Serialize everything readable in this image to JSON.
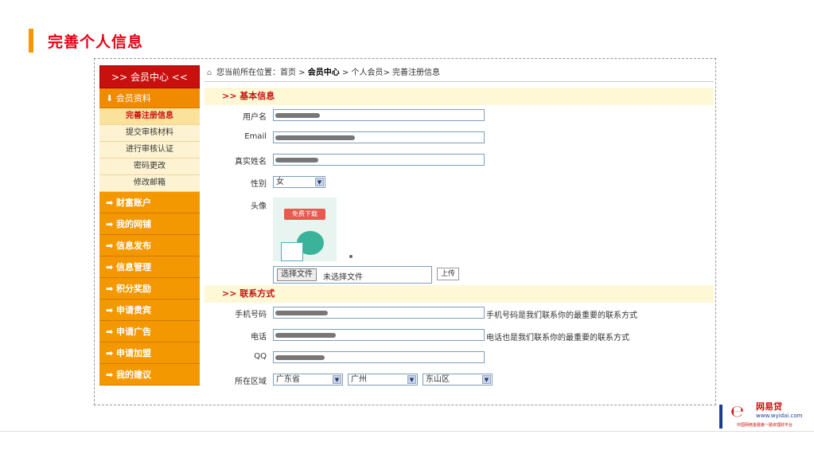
{
  "page_title": "完善个人信息",
  "sidebar": {
    "header": ">> 会员中心 <<",
    "section_member": "⬇ 会员资料",
    "sub_items": [
      "完善注册信息",
      "提交审核材料",
      "进行审核认证",
      "密码更改",
      "修改邮箱"
    ],
    "sections": [
      "➡ 财富账户",
      "➡ 我的网铺",
      "➡ 信息发布",
      "➡ 信息管理",
      "➡ 积分奖励",
      "➡ 申请贵宾",
      "➡ 申请广告",
      "➡ 申请加盟",
      "➡ 我的建议"
    ]
  },
  "breadcrumb": {
    "prefix": "您当前所在位置：首页 > ",
    "member_center": "会员中心",
    "suffix": " > 个人会员> 完善注册信息"
  },
  "basic_section_title": ">> 基本信息",
  "contact_section_title": ">> 联系方式",
  "form": {
    "username_label": "用户名",
    "email_label": "Email",
    "realname_label": "真实姓名",
    "gender_label": "性别",
    "gender_value": "女",
    "avatar_label": "头像",
    "avatar_badge": "免费下载",
    "file_button": "选择文件",
    "file_status": "未选择文件",
    "upload_button": "上传",
    "mobile_label": "手机号码",
    "mobile_note": "手机号码是我们联系你的最重要的联系方式",
    "phone_label": "电话",
    "phone_note": "电话也是我们联系你的最重要的联系方式",
    "qq_label": "QQ",
    "region_label": "所在区域",
    "province": "广东省",
    "city": "广州",
    "district": "东山区"
  },
  "logo": {
    "name": "网易贷",
    "url": "www.wyidai.com",
    "slogan": "中国网络金融第一融资理财平台"
  }
}
